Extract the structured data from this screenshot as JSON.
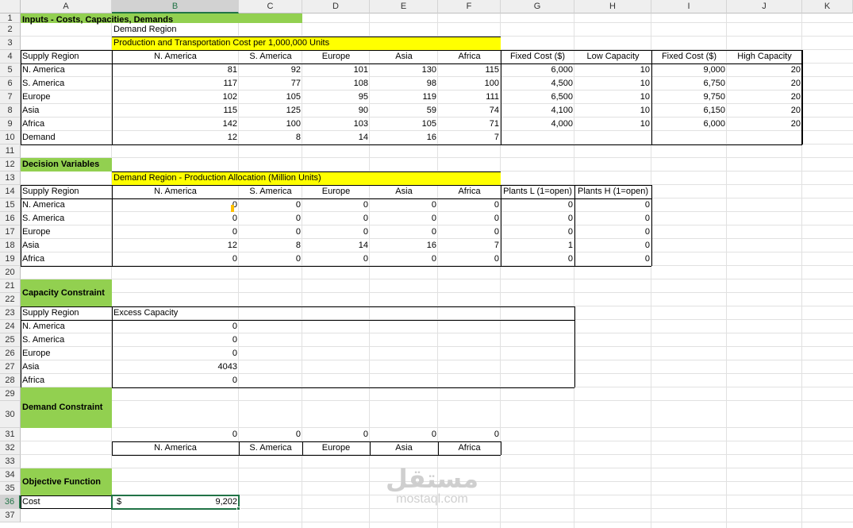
{
  "columns": [
    "A",
    "B",
    "C",
    "D",
    "E",
    "F",
    "G",
    "H",
    "I",
    "J",
    "K"
  ],
  "selected_column": "B",
  "selected_row": "36",
  "rows": [
    "1",
    "2",
    "3",
    "4",
    "5",
    "6",
    "7",
    "8",
    "9",
    "10",
    "11",
    "12",
    "13",
    "14",
    "15",
    "16",
    "17",
    "18",
    "19",
    "20",
    "21",
    "22",
    "23",
    "24",
    "25",
    "26",
    "27",
    "28",
    "29",
    "30",
    "31",
    "32",
    "33",
    "34",
    "35",
    "36",
    "37"
  ],
  "inputs": {
    "title": "Inputs - Costs, Capacities, Demands",
    "demand_region": "Demand Region",
    "cost_caption": "Production and Transportation Cost per 1,000,000 Units",
    "headers": [
      "Supply Region",
      "N. America",
      "S. America",
      "Europe",
      "Asia",
      "Africa",
      "Fixed Cost ($)",
      "Low Capacity",
      "Fixed Cost ($)",
      "High Capacity"
    ],
    "rows": [
      [
        "N. America",
        "81",
        "92",
        "101",
        "130",
        "115",
        "6,000",
        "10",
        "9,000",
        "20"
      ],
      [
        "S. America",
        "117",
        "77",
        "108",
        "98",
        "100",
        "4,500",
        "10",
        "6,750",
        "20"
      ],
      [
        "Europe",
        "102",
        "105",
        "95",
        "119",
        "111",
        "6,500",
        "10",
        "9,750",
        "20"
      ],
      [
        "Asia",
        "115",
        "125",
        "90",
        "59",
        "74",
        "4,100",
        "10",
        "6,150",
        "20"
      ],
      [
        "Africa",
        "142",
        "100",
        "103",
        "105",
        "71",
        "4,000",
        "10",
        "6,000",
        "20"
      ]
    ],
    "demand_row": [
      "Demand",
      "12",
      "8",
      "14",
      "16",
      "7"
    ]
  },
  "decision": {
    "title": "Decision Variables",
    "caption": "Demand Region - Production Allocation (Million Units)",
    "headers": [
      "Supply Region",
      "N. America",
      "S. America",
      "Europe",
      "Asia",
      "Africa",
      "Plants L (1=open)",
      "Plants H (1=open)"
    ],
    "rows": [
      [
        "N. America",
        "0",
        "0",
        "0",
        "0",
        "0",
        "0",
        "0"
      ],
      [
        "S. America",
        "0",
        "0",
        "0",
        "0",
        "0",
        "0",
        "0"
      ],
      [
        "Europe",
        "0",
        "0",
        "0",
        "0",
        "0",
        "0",
        "0"
      ],
      [
        "Asia",
        "12",
        "8",
        "14",
        "16",
        "7",
        "1",
        "0"
      ],
      [
        "Africa",
        "0",
        "0",
        "0",
        "0",
        "0",
        "0",
        "0"
      ]
    ]
  },
  "capacity": {
    "title": "Capacity Constraint",
    "header_supply": "Supply Region",
    "header_excess": "Excess Capacity",
    "rows": [
      [
        "N. America",
        "0"
      ],
      [
        "S. America",
        "0"
      ],
      [
        "Europe",
        "0"
      ],
      [
        "Asia",
        "4043"
      ],
      [
        "Africa",
        "0"
      ]
    ]
  },
  "demand_constraint": {
    "title": "Demand Constraint",
    "values": [
      "0",
      "0",
      "0",
      "0",
      "0"
    ],
    "labels": [
      "N. America",
      "S. America",
      "Europe",
      "Asia",
      "Africa"
    ]
  },
  "objective": {
    "title": "Objective Function",
    "label": "Cost",
    "currency": "$",
    "value": "9,202"
  },
  "watermark": {
    "arabic": "مستقل",
    "latin": "mostaql.com"
  },
  "colors": {
    "green": "#92d050",
    "yellow": "#ffff00",
    "excel_green": "#217346"
  }
}
